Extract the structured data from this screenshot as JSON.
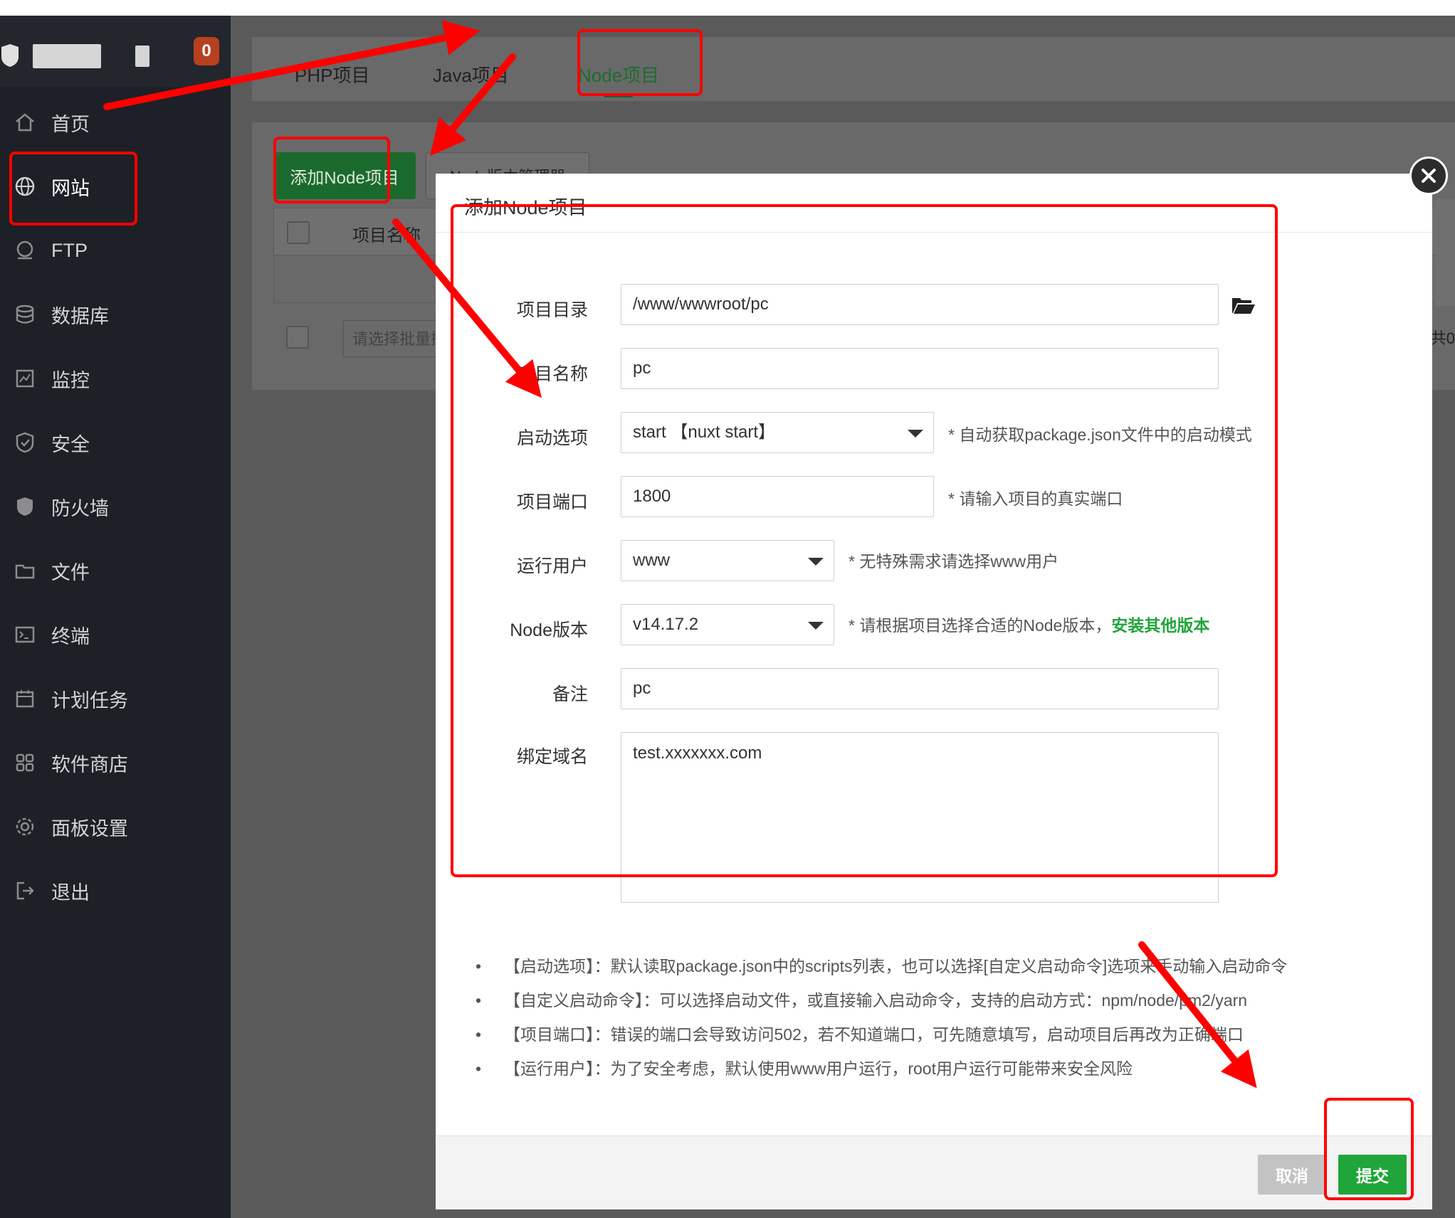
{
  "sidebar": {
    "badge": "0",
    "items": [
      {
        "label": "首页",
        "icon": "home-icon"
      },
      {
        "label": "网站",
        "icon": "globe-icon"
      },
      {
        "label": "FTP",
        "icon": "ftp-icon"
      },
      {
        "label": "数据库",
        "icon": "database-icon"
      },
      {
        "label": "监控",
        "icon": "monitor-icon"
      },
      {
        "label": "安全",
        "icon": "shield-check-icon"
      },
      {
        "label": "防火墙",
        "icon": "shield-icon"
      },
      {
        "label": "文件",
        "icon": "folder-icon"
      },
      {
        "label": "终端",
        "icon": "terminal-icon"
      },
      {
        "label": "计划任务",
        "icon": "calendar-icon"
      },
      {
        "label": "软件商店",
        "icon": "grid-icon"
      },
      {
        "label": "面板设置",
        "icon": "gear-icon"
      },
      {
        "label": "退出",
        "icon": "logout-icon"
      }
    ]
  },
  "tabs": [
    {
      "label": "PHP项目"
    },
    {
      "label": "Java项目"
    },
    {
      "label": "Node项目"
    }
  ],
  "panel": {
    "add_button": "添加Node项目",
    "version_manager_button": "Node版本管理器",
    "column_name": "项目名称",
    "batch_placeholder": "请选择批量操作",
    "pager_text": "共0"
  },
  "modal": {
    "title": "添加Node项目",
    "fields": {
      "dir": {
        "label": "项目目录",
        "value": "/www/wwwroot/pc"
      },
      "name": {
        "label": "项目名称",
        "value": "pc"
      },
      "start": {
        "label": "启动选项",
        "value": "start 【nuxt start】",
        "hint": "* 自动获取package.json文件中的启动模式"
      },
      "port": {
        "label": "项目端口",
        "value": "1800",
        "hint": "* 请输入项目的真实端口"
      },
      "user": {
        "label": "运行用户",
        "value": "www",
        "hint": "* 无特殊需求请选择www用户"
      },
      "node": {
        "label": "Node版本",
        "value": "v14.17.2",
        "hint": "* 请根据项目选择合适的Node版本，",
        "hint_link": "安装其他版本"
      },
      "remark": {
        "label": "备注",
        "value": "pc"
      },
      "domain": {
        "label": "绑定域名",
        "value": "test.xxxxxxx.com"
      }
    },
    "notes": [
      "【启动选项】：默认读取package.json中的scripts列表，也可以选择[自定义启动命令]选项来手动输入启动命令",
      "【自定义启动命令】：可以选择启动文件，或直接输入启动命令，支持的启动方式：npm/node/pm2/yarn",
      "【项目端口】：错误的端口会导致访问502，若不知道端口，可先随意填写，启动项目后再改为正确端口",
      "【运行用户】：为了安全考虑，默认使用www用户运行，root用户运行可能带来安全风险"
    ],
    "cancel": "取消",
    "submit": "提交"
  },
  "colors": {
    "accent_green": "#20a53a",
    "annotation_red": "#ff0000",
    "sidebar_bg": "#1d2026"
  }
}
